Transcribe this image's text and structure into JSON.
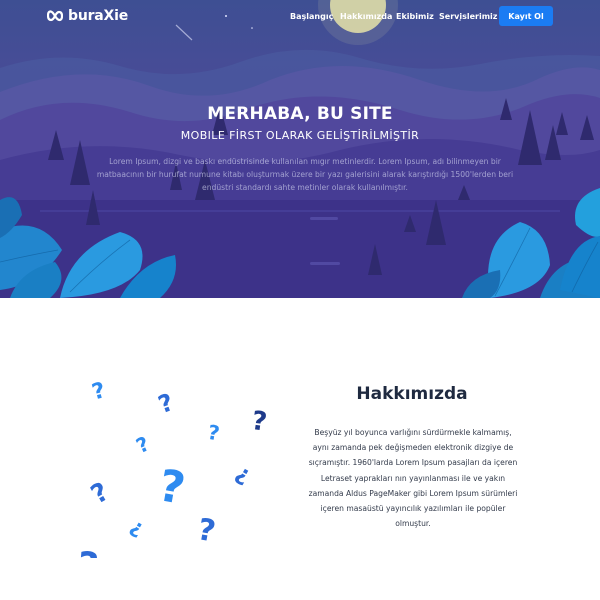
{
  "brand": {
    "name": "buraXie",
    "logo_icon": "infinity-logo-icon"
  },
  "nav": {
    "links": [
      "Başlangıç",
      "Hakkımızda",
      "Ekibimiz",
      "Servislerimiz"
    ],
    "signup_label": "Kayıt Ol"
  },
  "hero": {
    "title": "MERHABA, BU SITE",
    "subtitle": "MOBILE FİRST OLARAK GELİŞTİRİLMİŞTİR",
    "description": "Lorem Ipsum, dizgi ve baskı endüstrisinde kullanılan mıgır metinlerdir. Lorem Ipsum, adı bilinmeyen bir matbaacının bir hurufat numune kitabı oluşturmak üzere bir yazı galerisini alarak karıştırdığı 1500'lerden beri endüstri standardı sahte metinler olarak kullanılmıştır.",
    "illustration": "night-mountain-landscape"
  },
  "about": {
    "title": "Hakkımızda",
    "text": "Beşyüz yıl boyunca varlığını sürdürmekle kalmamış, aynı zamanda pek değişmeden elektronik dizgiye de sıçramıştır. 1960'larda Lorem Ipsum pasajları da içeren Letraset yaprakları nın yayınlanması ile ve yakın zamanda Aldus PageMaker gibi Lorem Ipsum sürümleri içeren masaüstü yayıncılık yazılımları ile popüler olmuştur.",
    "illustration": "question-marks-icon"
  },
  "colors": {
    "accent": "#1b7cf3",
    "hero_top": "#3e4f93",
    "hero_bottom": "#3f338a",
    "question_light": "#2e8bf0",
    "question_dark": "#1e3a8a"
  }
}
